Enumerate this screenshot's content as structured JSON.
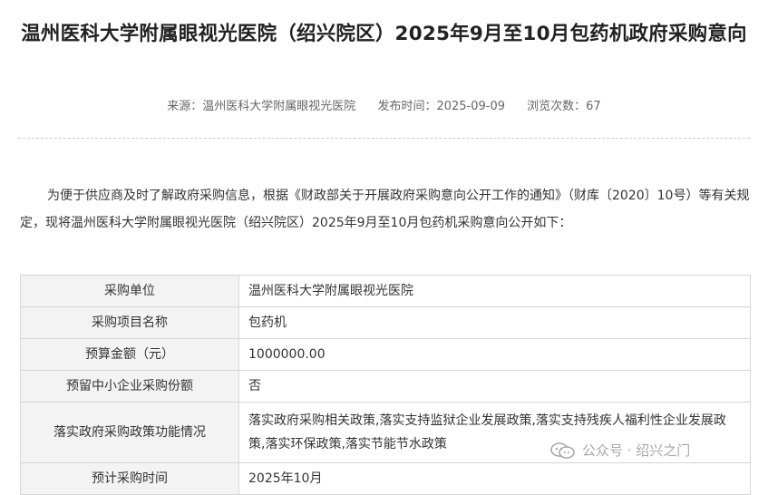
{
  "article": {
    "title": "温州医科大学附属眼视光医院（绍兴院区）2025年9月至10月包药机政府采购意向",
    "meta": {
      "source": "来源：温州医科大学附属眼视光医院",
      "published": "发布时间：2025-09-09",
      "views": "浏览次数：67"
    },
    "intro": "为便于供应商及时了解政府采购信息，根据《财政部关于开展政府采购意向公开工作的通知》（财库〔2020〕10号）等有关规定，现将温州医科大学附属眼视光医院（绍兴院区）2025年9月至10月包药机采购意向公开如下："
  },
  "table": {
    "rows": [
      {
        "label": "采购单位",
        "value": "温州医科大学附属眼视光医院"
      },
      {
        "label": "采购项目名称",
        "value": "包药机"
      },
      {
        "label": "预算金额（元）",
        "value": "1000000.00"
      },
      {
        "label": "预留中小企业采购份额",
        "value": "否"
      },
      {
        "label": "落实政府采购政策功能情况",
        "value": "落实政府采购相关政策,落实支持监狱企业发展政策,落实支持残疾人福利性企业发展政策,落实环保政策,落实节能节水政策"
      },
      {
        "label": "预计采购时间",
        "value": "2025年10月"
      }
    ]
  },
  "watermark": {
    "text": "公众号 · 绍兴之门",
    "icon": "wechat-icon"
  }
}
